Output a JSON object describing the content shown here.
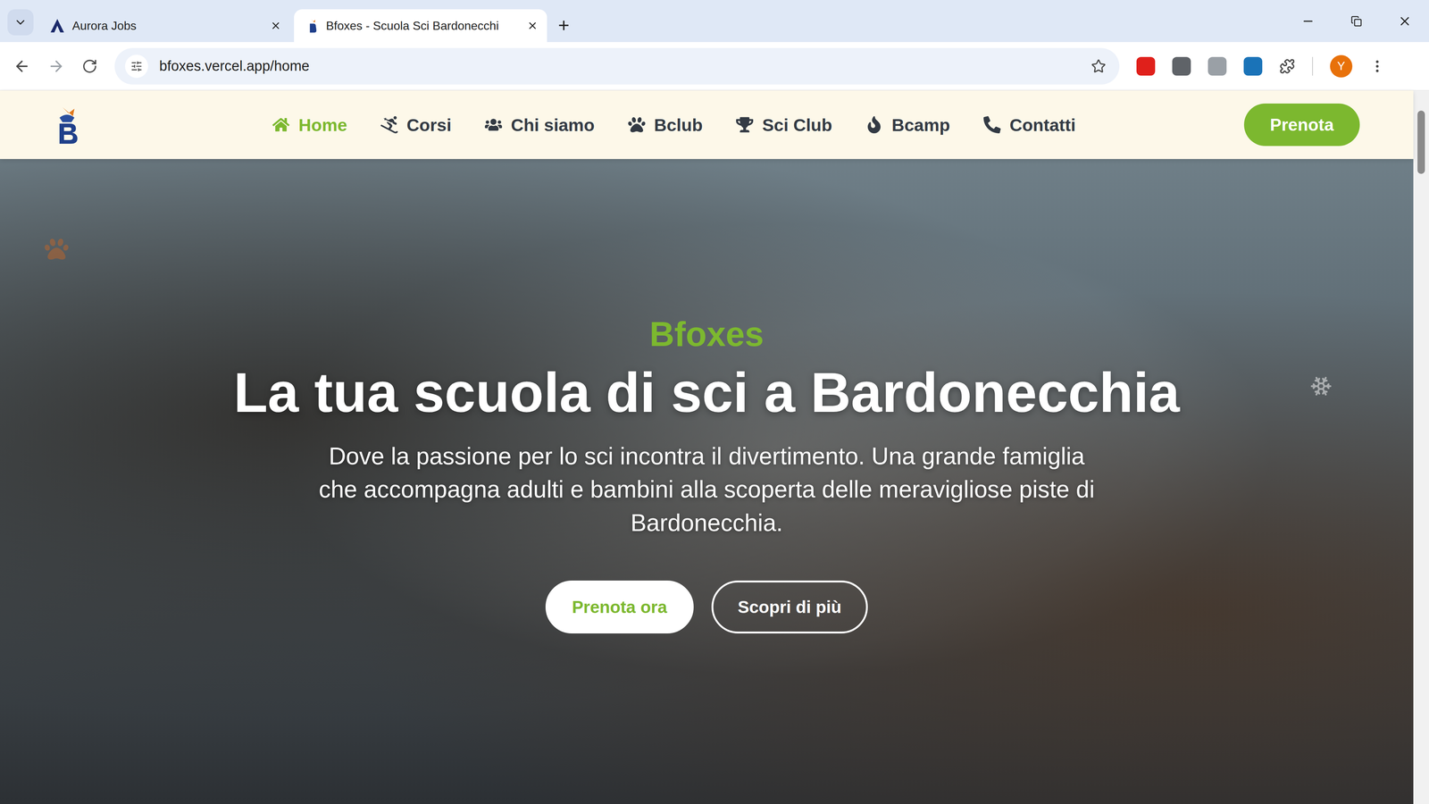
{
  "browser": {
    "tabs": [
      {
        "label": "Aurora Jobs",
        "selected": false
      },
      {
        "label": "Bfoxes - Scuola Sci Bardonecchi",
        "selected": true
      }
    ],
    "new_tab": "+",
    "url": "bfoxes.vercel.app/home",
    "profile": "Y"
  },
  "nav": {
    "items": [
      {
        "label": "Home",
        "selected": true
      },
      {
        "label": "Corsi",
        "selected": false
      },
      {
        "label": "Chi siamo",
        "selected": false
      },
      {
        "label": "Bclub",
        "selected": false
      },
      {
        "label": "Sci Club",
        "selected": false
      },
      {
        "label": "Bcamp",
        "selected": false
      },
      {
        "label": "Contatti",
        "selected": false
      }
    ],
    "cta": "Prenota"
  },
  "hero": {
    "kicker": "Bfoxes",
    "title": "La tua scuola di sci a Bardonecchia",
    "subtitle": "Dove la passione per lo sci incontra il divertimento. Una grande famiglia che accompagna adulti e bambini alla scoperta delle meravigliose piste di Bardonecchia.",
    "buttons": [
      {
        "label": "Prenota ora",
        "kind": "primary"
      },
      {
        "label": "Scopri di più",
        "kind": "outline"
      }
    ]
  }
}
